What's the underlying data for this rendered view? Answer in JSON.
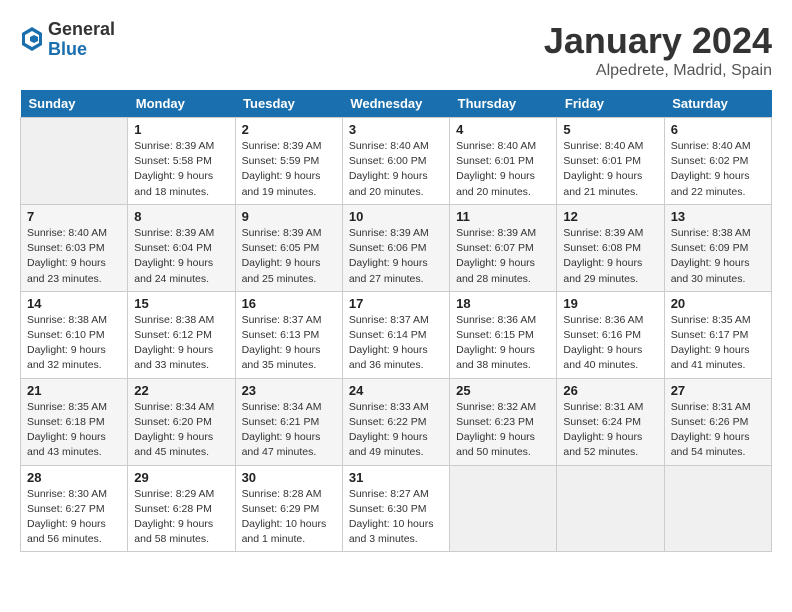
{
  "header": {
    "logo_general": "General",
    "logo_blue": "Blue",
    "month_title": "January 2024",
    "location": "Alpedrete, Madrid, Spain"
  },
  "calendar": {
    "days_of_week": [
      "Sunday",
      "Monday",
      "Tuesday",
      "Wednesday",
      "Thursday",
      "Friday",
      "Saturday"
    ],
    "weeks": [
      [
        {
          "day": "",
          "info": ""
        },
        {
          "day": "1",
          "info": "Sunrise: 8:39 AM\nSunset: 5:58 PM\nDaylight: 9 hours\nand 18 minutes."
        },
        {
          "day": "2",
          "info": "Sunrise: 8:39 AM\nSunset: 5:59 PM\nDaylight: 9 hours\nand 19 minutes."
        },
        {
          "day": "3",
          "info": "Sunrise: 8:40 AM\nSunset: 6:00 PM\nDaylight: 9 hours\nand 20 minutes."
        },
        {
          "day": "4",
          "info": "Sunrise: 8:40 AM\nSunset: 6:01 PM\nDaylight: 9 hours\nand 20 minutes."
        },
        {
          "day": "5",
          "info": "Sunrise: 8:40 AM\nSunset: 6:01 PM\nDaylight: 9 hours\nand 21 minutes."
        },
        {
          "day": "6",
          "info": "Sunrise: 8:40 AM\nSunset: 6:02 PM\nDaylight: 9 hours\nand 22 minutes."
        }
      ],
      [
        {
          "day": "7",
          "info": "Sunrise: 8:40 AM\nSunset: 6:03 PM\nDaylight: 9 hours\nand 23 minutes."
        },
        {
          "day": "8",
          "info": "Sunrise: 8:39 AM\nSunset: 6:04 PM\nDaylight: 9 hours\nand 24 minutes."
        },
        {
          "day": "9",
          "info": "Sunrise: 8:39 AM\nSunset: 6:05 PM\nDaylight: 9 hours\nand 25 minutes."
        },
        {
          "day": "10",
          "info": "Sunrise: 8:39 AM\nSunset: 6:06 PM\nDaylight: 9 hours\nand 27 minutes."
        },
        {
          "day": "11",
          "info": "Sunrise: 8:39 AM\nSunset: 6:07 PM\nDaylight: 9 hours\nand 28 minutes."
        },
        {
          "day": "12",
          "info": "Sunrise: 8:39 AM\nSunset: 6:08 PM\nDaylight: 9 hours\nand 29 minutes."
        },
        {
          "day": "13",
          "info": "Sunrise: 8:38 AM\nSunset: 6:09 PM\nDaylight: 9 hours\nand 30 minutes."
        }
      ],
      [
        {
          "day": "14",
          "info": "Sunrise: 8:38 AM\nSunset: 6:10 PM\nDaylight: 9 hours\nand 32 minutes."
        },
        {
          "day": "15",
          "info": "Sunrise: 8:38 AM\nSunset: 6:12 PM\nDaylight: 9 hours\nand 33 minutes."
        },
        {
          "day": "16",
          "info": "Sunrise: 8:37 AM\nSunset: 6:13 PM\nDaylight: 9 hours\nand 35 minutes."
        },
        {
          "day": "17",
          "info": "Sunrise: 8:37 AM\nSunset: 6:14 PM\nDaylight: 9 hours\nand 36 minutes."
        },
        {
          "day": "18",
          "info": "Sunrise: 8:36 AM\nSunset: 6:15 PM\nDaylight: 9 hours\nand 38 minutes."
        },
        {
          "day": "19",
          "info": "Sunrise: 8:36 AM\nSunset: 6:16 PM\nDaylight: 9 hours\nand 40 minutes."
        },
        {
          "day": "20",
          "info": "Sunrise: 8:35 AM\nSunset: 6:17 PM\nDaylight: 9 hours\nand 41 minutes."
        }
      ],
      [
        {
          "day": "21",
          "info": "Sunrise: 8:35 AM\nSunset: 6:18 PM\nDaylight: 9 hours\nand 43 minutes."
        },
        {
          "day": "22",
          "info": "Sunrise: 8:34 AM\nSunset: 6:20 PM\nDaylight: 9 hours\nand 45 minutes."
        },
        {
          "day": "23",
          "info": "Sunrise: 8:34 AM\nSunset: 6:21 PM\nDaylight: 9 hours\nand 47 minutes."
        },
        {
          "day": "24",
          "info": "Sunrise: 8:33 AM\nSunset: 6:22 PM\nDaylight: 9 hours\nand 49 minutes."
        },
        {
          "day": "25",
          "info": "Sunrise: 8:32 AM\nSunset: 6:23 PM\nDaylight: 9 hours\nand 50 minutes."
        },
        {
          "day": "26",
          "info": "Sunrise: 8:31 AM\nSunset: 6:24 PM\nDaylight: 9 hours\nand 52 minutes."
        },
        {
          "day": "27",
          "info": "Sunrise: 8:31 AM\nSunset: 6:26 PM\nDaylight: 9 hours\nand 54 minutes."
        }
      ],
      [
        {
          "day": "28",
          "info": "Sunrise: 8:30 AM\nSunset: 6:27 PM\nDaylight: 9 hours\nand 56 minutes."
        },
        {
          "day": "29",
          "info": "Sunrise: 8:29 AM\nSunset: 6:28 PM\nDaylight: 9 hours\nand 58 minutes."
        },
        {
          "day": "30",
          "info": "Sunrise: 8:28 AM\nSunset: 6:29 PM\nDaylight: 10 hours\nand 1 minute."
        },
        {
          "day": "31",
          "info": "Sunrise: 8:27 AM\nSunset: 6:30 PM\nDaylight: 10 hours\nand 3 minutes."
        },
        {
          "day": "",
          "info": ""
        },
        {
          "day": "",
          "info": ""
        },
        {
          "day": "",
          "info": ""
        }
      ]
    ]
  }
}
